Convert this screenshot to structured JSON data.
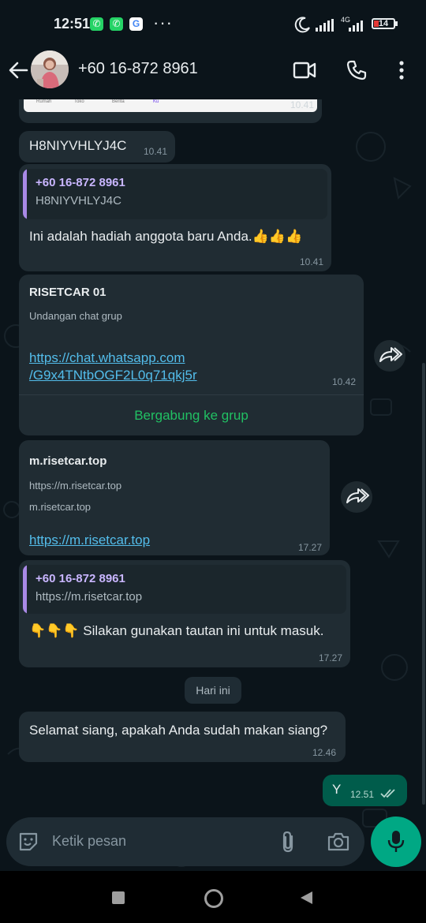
{
  "status_bar": {
    "time": "12:51",
    "network": "4G",
    "battery": "14"
  },
  "header": {
    "contact": "+60 16-872 8961"
  },
  "messages": {
    "preview_nav": [
      "Rumah",
      "Toko",
      "Berita",
      "Ku"
    ],
    "preview_time": "10.41",
    "m1": {
      "text": "H8NIYVHLYJ4C",
      "time": "10.41"
    },
    "m2": {
      "quote_name": "+60 16-872 8961",
      "quote_text": "H8NIYVHLYJ4C",
      "text": "Ini adalah hadiah anggota baru Anda.👍👍👍",
      "time": "10.41"
    },
    "m3": {
      "title": "RISETCAR 01",
      "subtitle": "Undangan chat grup",
      "link_line1": "https://chat.whatsapp.com",
      "link_line2": "/G9x4TNtbOGF2L0q71qkj5r",
      "time": "10.42",
      "action": "Bergabung ke grup"
    },
    "m4": {
      "title": "m.risetcar.top",
      "sub1": "https://m.risetcar.top",
      "sub2": "m.risetcar.top",
      "link": "https://m.risetcar.top",
      "time": "17.27"
    },
    "m5": {
      "quote_name": "+60 16-872 8961",
      "quote_text": "https://m.risetcar.top",
      "text": "👇👇👇 Silakan gunakan tautan ini untuk masuk.",
      "time": "17.27"
    },
    "date_divider": "Hari ini",
    "m6": {
      "text": "Selamat siang, apakah Anda sudah makan siang?",
      "time": "12.46"
    },
    "m7": {
      "text": "Y",
      "time": "12.51"
    }
  },
  "composer": {
    "placeholder": "Ketik pesan"
  },
  "colors": {
    "accent": "#00a884",
    "link": "#53bdeb",
    "join": "#21c063",
    "quote_bar": "#a989e6"
  }
}
